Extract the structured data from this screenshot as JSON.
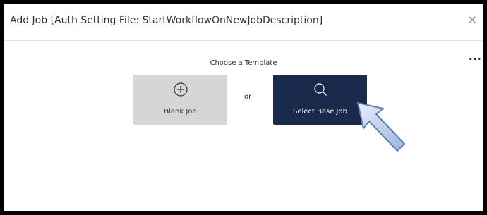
{
  "dialog": {
    "title": "Add Job [Auth Setting File: StartWorkflowOnNewJobDescription]",
    "close_glyph": "×",
    "more_glyph": "..."
  },
  "templates": {
    "heading": "Choose a Template",
    "separator": "or",
    "blank": {
      "label": "Blank Job",
      "icon": "plus-circle-icon"
    },
    "base": {
      "label": "Select Base Job",
      "icon": "search-icon"
    }
  },
  "colors": {
    "base_tile": "#1a2a4c",
    "blank_tile": "#d6d6d6",
    "pointer_arrow": "#b8c8e8"
  }
}
